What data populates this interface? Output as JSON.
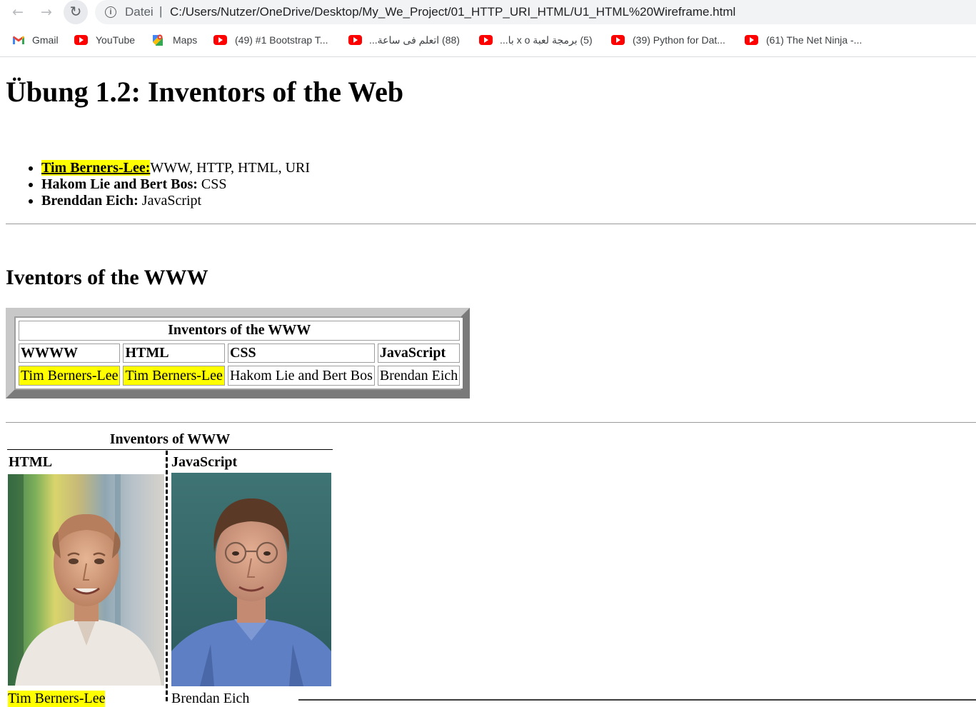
{
  "browser": {
    "scheme_label": "Datei",
    "url": "C:/Users/Nutzer/OneDrive/Desktop/My_We_Project/01_HTTP_URI_HTML/U1_HTML%20Wireframe.html",
    "icons": [
      "back-arrow-icon",
      "forward-arrow-icon",
      "reload-icon",
      "info-icon"
    ]
  },
  "bookmarks": [
    {
      "label": "Gmail",
      "icon": "gmail-icon"
    },
    {
      "label": "YouTube",
      "icon": "youtube-icon"
    },
    {
      "label": "Maps",
      "icon": "maps-icon"
    },
    {
      "label": "(49) #1 Bootstrap T...",
      "icon": "youtube-icon"
    },
    {
      "label": "(88) اتعلم فى ساعة...",
      "icon": "youtube-icon"
    },
    {
      "label": "(5) برمجة لعبة x o با...",
      "icon": "youtube-icon"
    },
    {
      "label": "(39) Python for Dat...",
      "icon": "youtube-icon"
    },
    {
      "label": "(61) The Net Ninja -...",
      "icon": "youtube-icon"
    }
  ],
  "page": {
    "title": "Übung 1.2: Inventors of the Web",
    "list": [
      {
        "name": "Tim Berners-Lee:",
        "tech": "WWW, HTTP, HTML, URI"
      },
      {
        "name": "Hakom Lie and Bert Bos:",
        "tech": " CSS"
      },
      {
        "name": "Brenddan Eich:",
        "tech": " JavaScript"
      }
    ],
    "section_title": "Iventors of the WWW",
    "table": {
      "caption": "Inventors of the WWW",
      "headers": [
        "WWWW",
        "HTML",
        "CSS",
        "JavaScript"
      ],
      "row": [
        "Tim Berners-Lee",
        "Tim Berners-Lee",
        "Hakom Lie and Bert Bos",
        "Brendan Eich"
      ]
    },
    "photos": {
      "caption": "Inventors of WWW",
      "col1_head": "HTML",
      "col2_head": "JavaScript",
      "col1_name": "Tim Berners-Lee",
      "col2_name": "Brendan Eich"
    },
    "colors": {
      "highlight": "#ffff00",
      "frame_light": "#c8c8c8",
      "frame_dark": "#7a7a7a"
    }
  }
}
